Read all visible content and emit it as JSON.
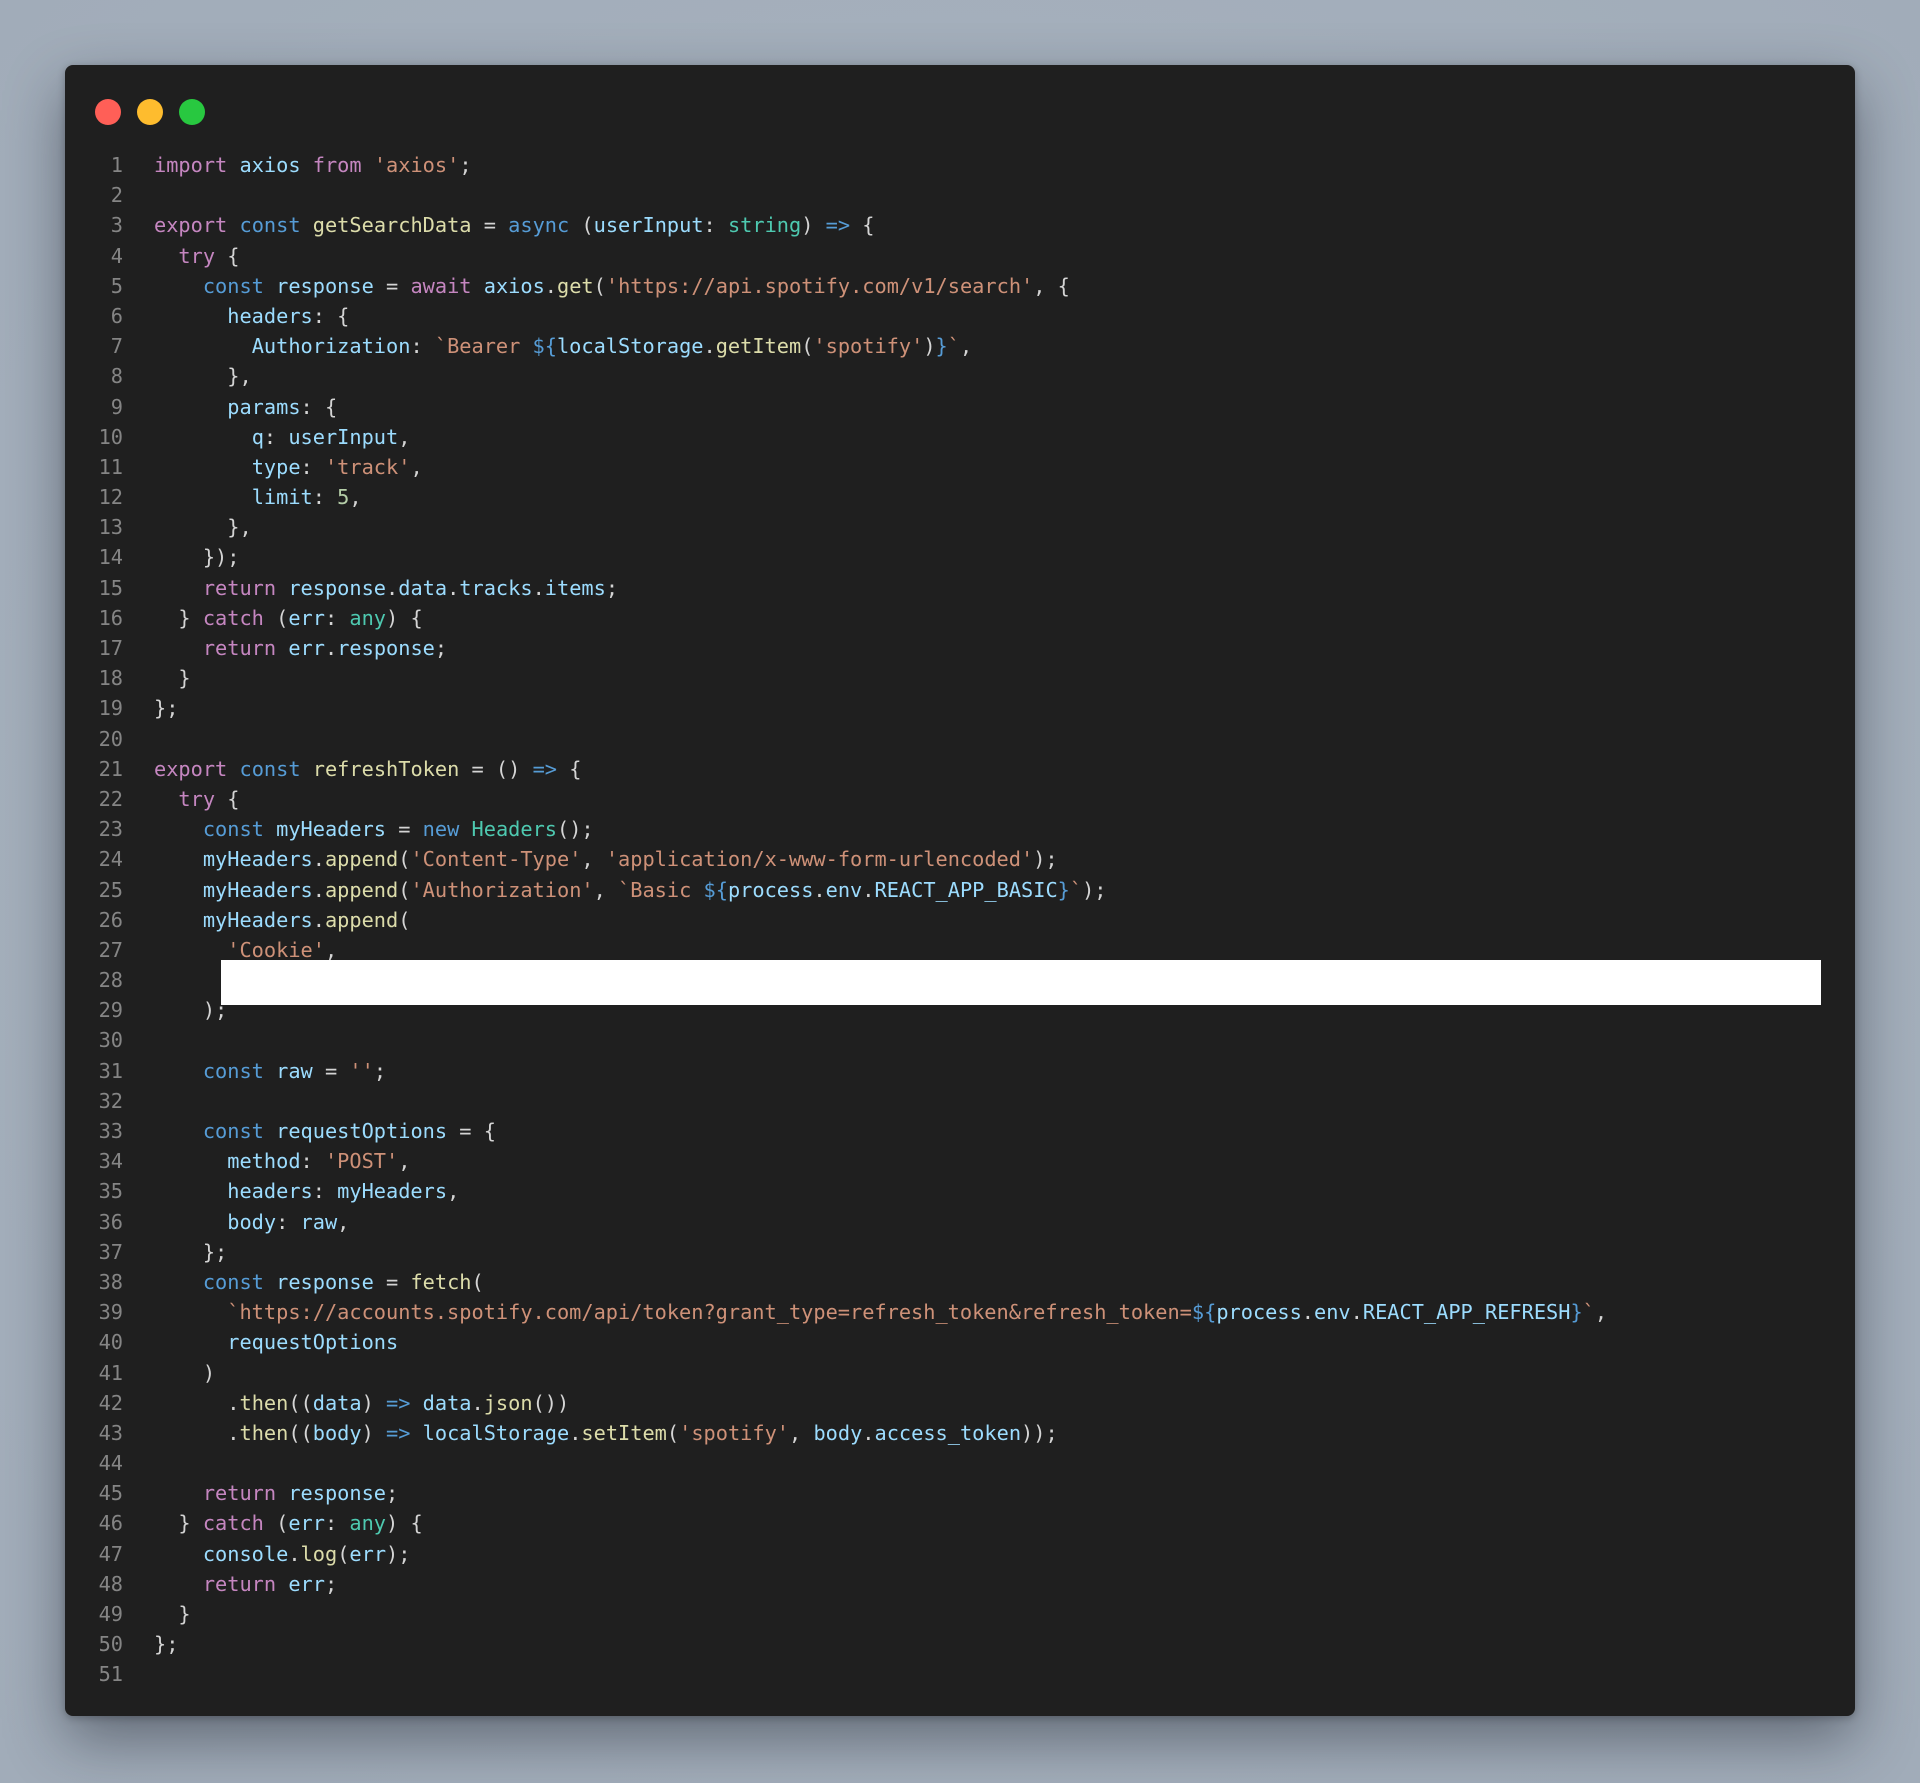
{
  "window": {
    "controls": [
      {
        "name": "close-button",
        "color": "#ff5f57"
      },
      {
        "name": "minimize-button",
        "color": "#febc2e"
      },
      {
        "name": "zoom-button",
        "color": "#28c840"
      }
    ]
  },
  "colors": {
    "background": "#a4afbb",
    "editor": "#1f1f1f",
    "line_number": "#858585",
    "keyword": "#c586c0",
    "storage": "#569cd6",
    "variable": "#9cdcfe",
    "function": "#dcdcaa",
    "type": "#4ec9b0",
    "string": "#ce9178",
    "number": "#b5cea8",
    "punctuation": "#d4d4d4"
  },
  "redaction": {
    "line": 28
  },
  "lines": [
    {
      "n": "1",
      "tokens": [
        [
          "k",
          "import"
        ],
        [
          "p",
          " "
        ],
        [
          "v",
          "axios"
        ],
        [
          "p",
          " "
        ],
        [
          "k",
          "from"
        ],
        [
          "p",
          " "
        ],
        [
          "r",
          "'axios'"
        ],
        [
          "p",
          ";"
        ]
      ]
    },
    {
      "n": "2",
      "tokens": []
    },
    {
      "n": "3",
      "tokens": [
        [
          "k",
          "export"
        ],
        [
          "p",
          " "
        ],
        [
          "s",
          "const"
        ],
        [
          "p",
          " "
        ],
        [
          "f",
          "getSearchData"
        ],
        [
          "p",
          " = "
        ],
        [
          "s",
          "async"
        ],
        [
          "p",
          " ("
        ],
        [
          "v",
          "userInput"
        ],
        [
          "p",
          ": "
        ],
        [
          "t",
          "string"
        ],
        [
          "p",
          ") "
        ],
        [
          "s",
          "=>"
        ],
        [
          "p",
          " {"
        ]
      ]
    },
    {
      "n": "4",
      "tokens": [
        [
          "p",
          "  "
        ],
        [
          "k",
          "try"
        ],
        [
          "p",
          " {"
        ]
      ]
    },
    {
      "n": "5",
      "tokens": [
        [
          "p",
          "    "
        ],
        [
          "s",
          "const"
        ],
        [
          "p",
          " "
        ],
        [
          "v",
          "response"
        ],
        [
          "p",
          " = "
        ],
        [
          "k",
          "await"
        ],
        [
          "p",
          " "
        ],
        [
          "v",
          "axios"
        ],
        [
          "p",
          "."
        ],
        [
          "f",
          "get"
        ],
        [
          "p",
          "("
        ],
        [
          "r",
          "'https://api.spotify.com/v1/search'"
        ],
        [
          "p",
          ", {"
        ]
      ]
    },
    {
      "n": "6",
      "tokens": [
        [
          "p",
          "      "
        ],
        [
          "v",
          "headers"
        ],
        [
          "p",
          ": {"
        ]
      ]
    },
    {
      "n": "7",
      "tokens": [
        [
          "p",
          "        "
        ],
        [
          "v",
          "Authorization"
        ],
        [
          "p",
          ": "
        ],
        [
          "r",
          "`Bearer "
        ],
        [
          "s",
          "${"
        ],
        [
          "v",
          "localStorage"
        ],
        [
          "p",
          "."
        ],
        [
          "f",
          "getItem"
        ],
        [
          "p",
          "("
        ],
        [
          "r",
          "'spotify'"
        ],
        [
          "p",
          ")"
        ],
        [
          "s",
          "}"
        ],
        [
          "r",
          "`"
        ],
        [
          "p",
          ","
        ]
      ]
    },
    {
      "n": "8",
      "tokens": [
        [
          "p",
          "      },"
        ]
      ]
    },
    {
      "n": "9",
      "tokens": [
        [
          "p",
          "      "
        ],
        [
          "v",
          "params"
        ],
        [
          "p",
          ": {"
        ]
      ]
    },
    {
      "n": "10",
      "tokens": [
        [
          "p",
          "        "
        ],
        [
          "v",
          "q"
        ],
        [
          "p",
          ": "
        ],
        [
          "v",
          "userInput"
        ],
        [
          "p",
          ","
        ]
      ]
    },
    {
      "n": "11",
      "tokens": [
        [
          "p",
          "        "
        ],
        [
          "v",
          "type"
        ],
        [
          "p",
          ": "
        ],
        [
          "r",
          "'track'"
        ],
        [
          "p",
          ","
        ]
      ]
    },
    {
      "n": "12",
      "tokens": [
        [
          "p",
          "        "
        ],
        [
          "v",
          "limit"
        ],
        [
          "p",
          ": "
        ],
        [
          "n",
          "5"
        ],
        [
          "p",
          ","
        ]
      ]
    },
    {
      "n": "13",
      "tokens": [
        [
          "p",
          "      },"
        ]
      ]
    },
    {
      "n": "14",
      "tokens": [
        [
          "p",
          "    });"
        ]
      ]
    },
    {
      "n": "15",
      "tokens": [
        [
          "p",
          "    "
        ],
        [
          "k",
          "return"
        ],
        [
          "p",
          " "
        ],
        [
          "v",
          "response"
        ],
        [
          "p",
          "."
        ],
        [
          "v",
          "data"
        ],
        [
          "p",
          "."
        ],
        [
          "v",
          "tracks"
        ],
        [
          "p",
          "."
        ],
        [
          "v",
          "items"
        ],
        [
          "p",
          ";"
        ]
      ]
    },
    {
      "n": "16",
      "tokens": [
        [
          "p",
          "  } "
        ],
        [
          "k",
          "catch"
        ],
        [
          "p",
          " ("
        ],
        [
          "v",
          "err"
        ],
        [
          "p",
          ": "
        ],
        [
          "t",
          "any"
        ],
        [
          "p",
          ") {"
        ]
      ]
    },
    {
      "n": "17",
      "tokens": [
        [
          "p",
          "    "
        ],
        [
          "k",
          "return"
        ],
        [
          "p",
          " "
        ],
        [
          "v",
          "err"
        ],
        [
          "p",
          "."
        ],
        [
          "v",
          "response"
        ],
        [
          "p",
          ";"
        ]
      ]
    },
    {
      "n": "18",
      "tokens": [
        [
          "p",
          "  }"
        ]
      ]
    },
    {
      "n": "19",
      "tokens": [
        [
          "p",
          "};"
        ]
      ]
    },
    {
      "n": "20",
      "tokens": []
    },
    {
      "n": "21",
      "tokens": [
        [
          "k",
          "export"
        ],
        [
          "p",
          " "
        ],
        [
          "s",
          "const"
        ],
        [
          "p",
          " "
        ],
        [
          "f",
          "refreshToken"
        ],
        [
          "p",
          " = () "
        ],
        [
          "s",
          "=>"
        ],
        [
          "p",
          " {"
        ]
      ]
    },
    {
      "n": "22",
      "tokens": [
        [
          "p",
          "  "
        ],
        [
          "k",
          "try"
        ],
        [
          "p",
          " {"
        ]
      ]
    },
    {
      "n": "23",
      "tokens": [
        [
          "p",
          "    "
        ],
        [
          "s",
          "const"
        ],
        [
          "p",
          " "
        ],
        [
          "v",
          "myHeaders"
        ],
        [
          "p",
          " = "
        ],
        [
          "s",
          "new"
        ],
        [
          "p",
          " "
        ],
        [
          "t",
          "Headers"
        ],
        [
          "p",
          "();"
        ]
      ]
    },
    {
      "n": "24",
      "tokens": [
        [
          "p",
          "    "
        ],
        [
          "v",
          "myHeaders"
        ],
        [
          "p",
          "."
        ],
        [
          "f",
          "append"
        ],
        [
          "p",
          "("
        ],
        [
          "r",
          "'Content-Type'"
        ],
        [
          "p",
          ", "
        ],
        [
          "r",
          "'application/x-www-form-urlencoded'"
        ],
        [
          "p",
          ");"
        ]
      ]
    },
    {
      "n": "25",
      "tokens": [
        [
          "p",
          "    "
        ],
        [
          "v",
          "myHeaders"
        ],
        [
          "p",
          "."
        ],
        [
          "f",
          "append"
        ],
        [
          "p",
          "("
        ],
        [
          "r",
          "'Authorization'"
        ],
        [
          "p",
          ", "
        ],
        [
          "r",
          "`Basic "
        ],
        [
          "s",
          "${"
        ],
        [
          "v",
          "process"
        ],
        [
          "p",
          "."
        ],
        [
          "v",
          "env"
        ],
        [
          "p",
          "."
        ],
        [
          "v",
          "REACT_APP_BASIC"
        ],
        [
          "s",
          "}"
        ],
        [
          "r",
          "`"
        ],
        [
          "p",
          ");"
        ]
      ]
    },
    {
      "n": "26",
      "tokens": [
        [
          "p",
          "    "
        ],
        [
          "v",
          "myHeaders"
        ],
        [
          "p",
          "."
        ],
        [
          "f",
          "append"
        ],
        [
          "p",
          "("
        ]
      ]
    },
    {
      "n": "27",
      "tokens": [
        [
          "p",
          "      "
        ],
        [
          "r",
          "'Cookie'"
        ],
        [
          "p",
          ","
        ]
      ]
    },
    {
      "n": "28",
      "tokens": []
    },
    {
      "n": "29",
      "tokens": [
        [
          "p",
          "    );"
        ]
      ]
    },
    {
      "n": "30",
      "tokens": []
    },
    {
      "n": "31",
      "tokens": [
        [
          "p",
          "    "
        ],
        [
          "s",
          "const"
        ],
        [
          "p",
          " "
        ],
        [
          "v",
          "raw"
        ],
        [
          "p",
          " = "
        ],
        [
          "r",
          "''"
        ],
        [
          "p",
          ";"
        ]
      ]
    },
    {
      "n": "32",
      "tokens": []
    },
    {
      "n": "33",
      "tokens": [
        [
          "p",
          "    "
        ],
        [
          "s",
          "const"
        ],
        [
          "p",
          " "
        ],
        [
          "v",
          "requestOptions"
        ],
        [
          "p",
          " = {"
        ]
      ]
    },
    {
      "n": "34",
      "tokens": [
        [
          "p",
          "      "
        ],
        [
          "v",
          "method"
        ],
        [
          "p",
          ": "
        ],
        [
          "r",
          "'POST'"
        ],
        [
          "p",
          ","
        ]
      ]
    },
    {
      "n": "35",
      "tokens": [
        [
          "p",
          "      "
        ],
        [
          "v",
          "headers"
        ],
        [
          "p",
          ": "
        ],
        [
          "v",
          "myHeaders"
        ],
        [
          "p",
          ","
        ]
      ]
    },
    {
      "n": "36",
      "tokens": [
        [
          "p",
          "      "
        ],
        [
          "v",
          "body"
        ],
        [
          "p",
          ": "
        ],
        [
          "v",
          "raw"
        ],
        [
          "p",
          ","
        ]
      ]
    },
    {
      "n": "37",
      "tokens": [
        [
          "p",
          "    };"
        ]
      ]
    },
    {
      "n": "38",
      "tokens": [
        [
          "p",
          "    "
        ],
        [
          "s",
          "const"
        ],
        [
          "p",
          " "
        ],
        [
          "v",
          "response"
        ],
        [
          "p",
          " = "
        ],
        [
          "f",
          "fetch"
        ],
        [
          "p",
          "("
        ]
      ]
    },
    {
      "n": "39",
      "tokens": [
        [
          "p",
          "      "
        ],
        [
          "r",
          "`https://accounts.spotify.com/api/token?grant_type=refresh_token&refresh_token="
        ],
        [
          "s",
          "${"
        ],
        [
          "v",
          "process"
        ],
        [
          "p",
          "."
        ],
        [
          "v",
          "env"
        ],
        [
          "p",
          "."
        ],
        [
          "v",
          "REACT_APP_REFRESH"
        ],
        [
          "s",
          "}"
        ],
        [
          "r",
          "`"
        ],
        [
          "p",
          ","
        ]
      ]
    },
    {
      "n": "40",
      "tokens": [
        [
          "p",
          "      "
        ],
        [
          "v",
          "requestOptions"
        ]
      ]
    },
    {
      "n": "41",
      "tokens": [
        [
          "p",
          "    )"
        ]
      ]
    },
    {
      "n": "42",
      "tokens": [
        [
          "p",
          "      ."
        ],
        [
          "f",
          "then"
        ],
        [
          "p",
          "(("
        ],
        [
          "v",
          "data"
        ],
        [
          "p",
          ") "
        ],
        [
          "s",
          "=>"
        ],
        [
          "p",
          " "
        ],
        [
          "v",
          "data"
        ],
        [
          "p",
          "."
        ],
        [
          "f",
          "json"
        ],
        [
          "p",
          "())"
        ]
      ]
    },
    {
      "n": "43",
      "tokens": [
        [
          "p",
          "      ."
        ],
        [
          "f",
          "then"
        ],
        [
          "p",
          "(("
        ],
        [
          "v",
          "body"
        ],
        [
          "p",
          ") "
        ],
        [
          "s",
          "=>"
        ],
        [
          "p",
          " "
        ],
        [
          "v",
          "localStorage"
        ],
        [
          "p",
          "."
        ],
        [
          "f",
          "setItem"
        ],
        [
          "p",
          "("
        ],
        [
          "r",
          "'spotify'"
        ],
        [
          "p",
          ", "
        ],
        [
          "v",
          "body"
        ],
        [
          "p",
          "."
        ],
        [
          "v",
          "access_token"
        ],
        [
          "p",
          "));"
        ]
      ]
    },
    {
      "n": "44",
      "tokens": []
    },
    {
      "n": "45",
      "tokens": [
        [
          "p",
          "    "
        ],
        [
          "k",
          "return"
        ],
        [
          "p",
          " "
        ],
        [
          "v",
          "response"
        ],
        [
          "p",
          ";"
        ]
      ]
    },
    {
      "n": "46",
      "tokens": [
        [
          "p",
          "  } "
        ],
        [
          "k",
          "catch"
        ],
        [
          "p",
          " ("
        ],
        [
          "v",
          "err"
        ],
        [
          "p",
          ": "
        ],
        [
          "t",
          "any"
        ],
        [
          "p",
          ") {"
        ]
      ]
    },
    {
      "n": "47",
      "tokens": [
        [
          "p",
          "    "
        ],
        [
          "v",
          "console"
        ],
        [
          "p",
          "."
        ],
        [
          "f",
          "log"
        ],
        [
          "p",
          "("
        ],
        [
          "v",
          "err"
        ],
        [
          "p",
          ");"
        ]
      ]
    },
    {
      "n": "48",
      "tokens": [
        [
          "p",
          "    "
        ],
        [
          "k",
          "return"
        ],
        [
          "p",
          " "
        ],
        [
          "v",
          "err"
        ],
        [
          "p",
          ";"
        ]
      ]
    },
    {
      "n": "49",
      "tokens": [
        [
          "p",
          "  }"
        ]
      ]
    },
    {
      "n": "50",
      "tokens": [
        [
          "p",
          "};"
        ]
      ]
    },
    {
      "n": "51",
      "tokens": []
    }
  ]
}
